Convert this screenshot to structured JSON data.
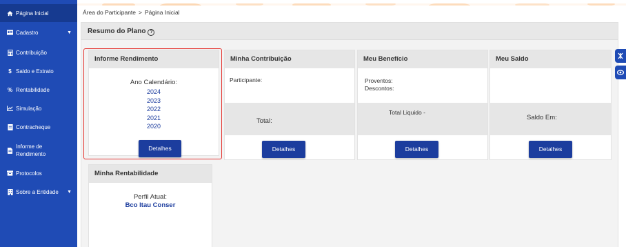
{
  "sidebar": {
    "items": [
      {
        "label": "Página Inicial",
        "icon": "home-icon",
        "active": true
      },
      {
        "label": "Cadastro",
        "icon": "id-card-icon",
        "caret": true
      },
      {
        "label": "Contribuição",
        "icon": "calculator-icon"
      },
      {
        "label": "Saldo e Extrato",
        "icon": "dollar-icon"
      },
      {
        "label": "Rentabilidade",
        "icon": "percent-icon"
      },
      {
        "label": "Simulação",
        "icon": "chart-line-icon"
      },
      {
        "label": "Contracheque",
        "icon": "money-icon"
      },
      {
        "label": "Informe de Rendimento",
        "icon": "file-icon"
      },
      {
        "label": "Protocolos",
        "icon": "archive-icon"
      },
      {
        "label": "Sobre a Entidade",
        "icon": "building-icon",
        "caret": true
      }
    ]
  },
  "breadcrumb": {
    "parent": "Área do Participante",
    "separator": ">",
    "current": "Página Inicial"
  },
  "panel": {
    "title": "Resumo do Plano"
  },
  "cards": {
    "informe": {
      "title": "Informe Rendimento",
      "label": "Ano Calendário:",
      "years": [
        "2024",
        "2023",
        "2022",
        "2021",
        "2020"
      ],
      "button": "Detalhes"
    },
    "contribuicao": {
      "title": "Minha Contribuição",
      "participante": "Participante:",
      "total": "Total:",
      "button": "Detalhes"
    },
    "beneficio": {
      "title": "Meu Benefício",
      "proventos": "Proventos:",
      "descontos": "Descontos:",
      "total_liquido": "Total Liquido -",
      "button": "Detalhes"
    },
    "saldo": {
      "title": "Meu Saldo",
      "saldo_em": "Saldo Em:",
      "button": "Detalhes"
    },
    "rentabilidade": {
      "title": "Minha Rentabilidade",
      "perfil_label": "Perfil Atual:",
      "perfil_value": "Bco Itau Conser"
    }
  },
  "colors": {
    "sidebar": "#1f4bb5",
    "button": "#1c3d9e",
    "highlight": "#e53935",
    "accent_band": "#f7a04a"
  }
}
